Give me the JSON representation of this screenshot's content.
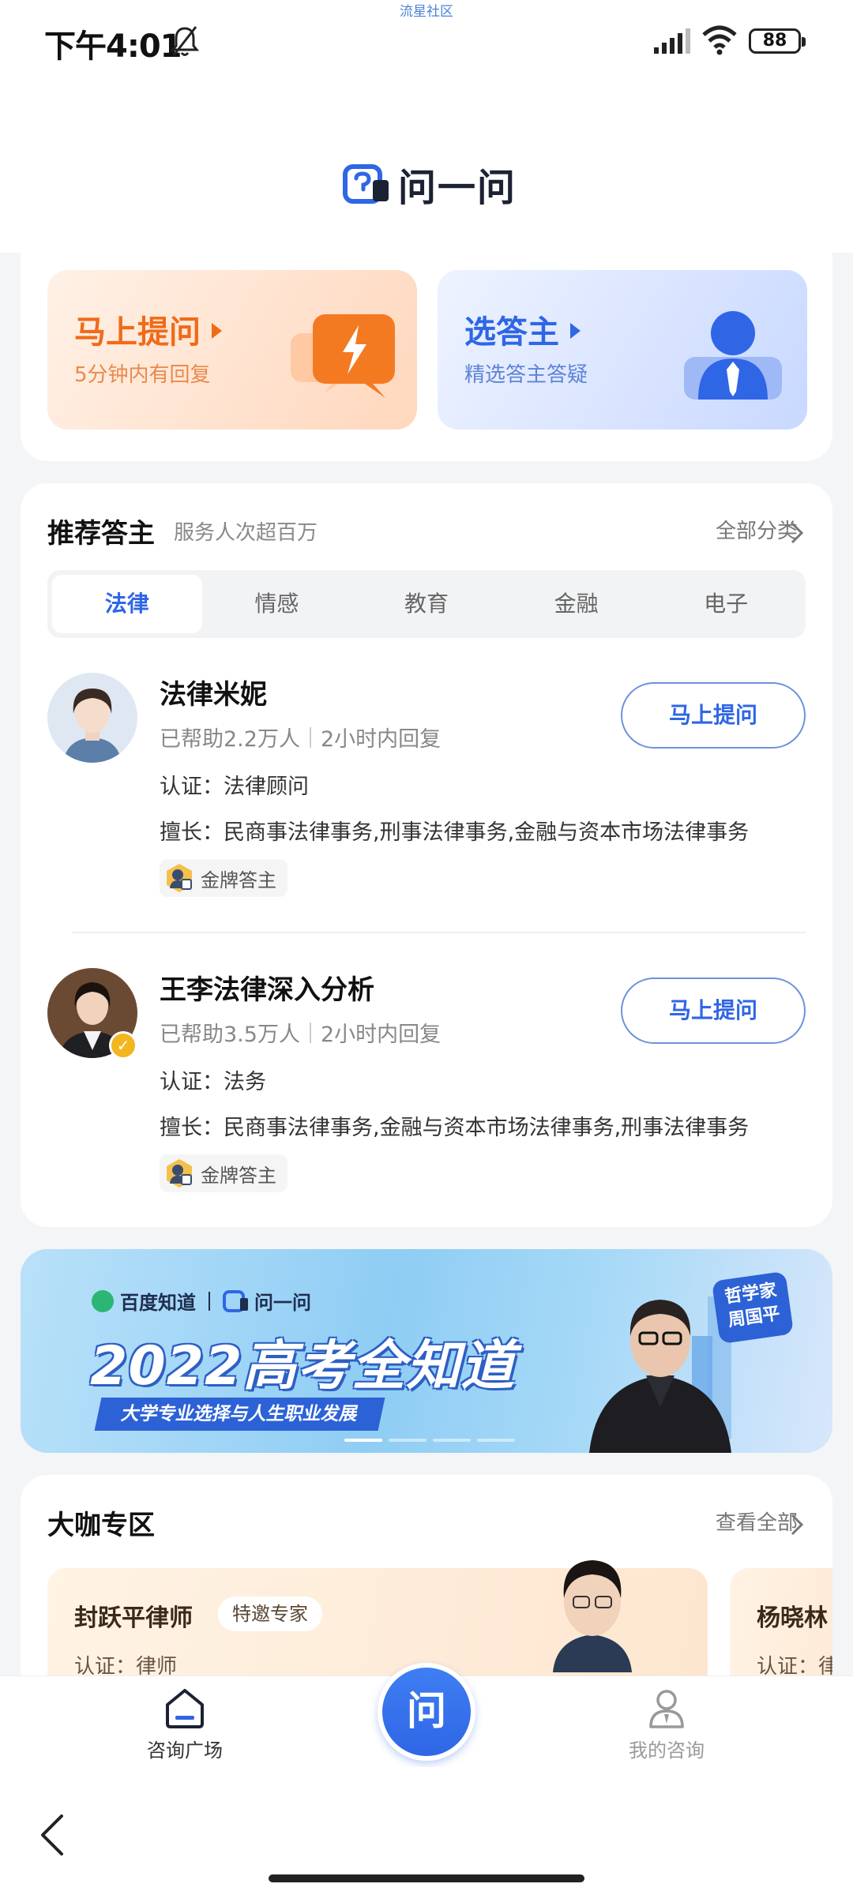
{
  "status_bar": {
    "time": "下午4:01",
    "watermark": "流星社区",
    "battery": "88"
  },
  "header": {
    "logo_text": "问一问"
  },
  "quick_actions": {
    "ask": {
      "title": "马上提问",
      "subtitle": "5分钟内有回复"
    },
    "select": {
      "title": "选答主",
      "subtitle": "精选答主答疑"
    }
  },
  "recommended": {
    "title": "推荐答主",
    "subtitle": "服务人次超百万",
    "more_label": "全部分类",
    "tabs": [
      "法律",
      "情感",
      "教育",
      "金融",
      "电子"
    ],
    "experts": [
      {
        "name": "法律米妮",
        "helped": "已帮助2.2万人",
        "reply": "2小时内回复",
        "cert": "认证：法律顾问",
        "skill": "擅长：民商事法律事务,刑事法律事务,金融与资本市场法律事务",
        "tag": "金牌答主",
        "button": "马上提问"
      },
      {
        "name": "王李法律深入分析",
        "helped": "已帮助3.5万人",
        "reply": "2小时内回复",
        "cert": "认证：法务",
        "skill": "擅长：民商事法律事务,金融与资本市场法律事务,刑事法律事务",
        "tag": "金牌答主",
        "button": "马上提问"
      }
    ]
  },
  "banner": {
    "brand_baidu": "百度知道",
    "brand_wyw": "问一问",
    "headline": "2022高考全知道",
    "tagline": "大学专业选择与人生职业发展",
    "badge_line1": "哲学家",
    "badge_line2": "周国平"
  },
  "bigshot": {
    "title": "大咖专区",
    "more_label": "查看全部",
    "items": [
      {
        "name": "封跃平律师",
        "tag": "特邀专家",
        "cert": "认证：律师"
      },
      {
        "name": "杨晓林",
        "cert": "认证：律"
      }
    ]
  },
  "bottom_nav": {
    "home_label": "咨询广场",
    "center_label": "问",
    "mine_label": "我的咨询"
  },
  "colors": {
    "primary": "#2f66e6",
    "orange": "#f06a18",
    "gold": "#f3b61f"
  }
}
